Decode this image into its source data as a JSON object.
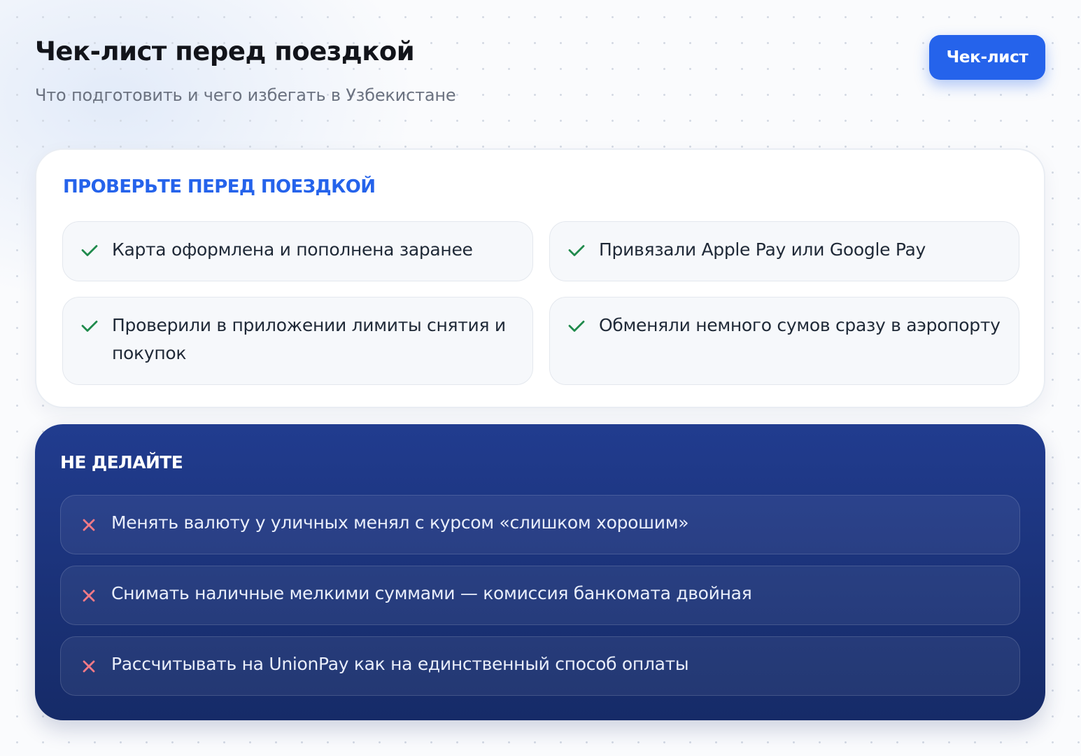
{
  "header": {
    "title": "Чек-лист перед поездкой",
    "subtitle": "Что подготовить и чего избегать в Узбекистане",
    "button_label": "Чек-лист"
  },
  "check_section": {
    "title": "ПРОВЕРЬТЕ ПЕРЕД ПОЕЗДКОЙ",
    "icon": "check-icon",
    "icon_color": "#1f8a4c",
    "items": [
      "Карта оформлена и пополнена заранее",
      "Привязали Apple Pay или Google Pay",
      "Проверили в приложении лимиты снятия и покупок",
      "Обменяли немного сумов сразу в аэропорту"
    ]
  },
  "dont_section": {
    "title": "НЕ ДЕЛАЙТЕ",
    "icon": "close-icon",
    "icon_color": "#f47a86",
    "items": [
      "Менять валюту у уличных менял с курсом «слишком хорошим»",
      "Снимать наличные мелкими суммами — комиссия банкомата двойная",
      "Рассчитывать на UnionPay как на единственный способ оплаты"
    ]
  },
  "colors": {
    "accent": "#2563eb",
    "dark_panel": "#1c3580"
  }
}
